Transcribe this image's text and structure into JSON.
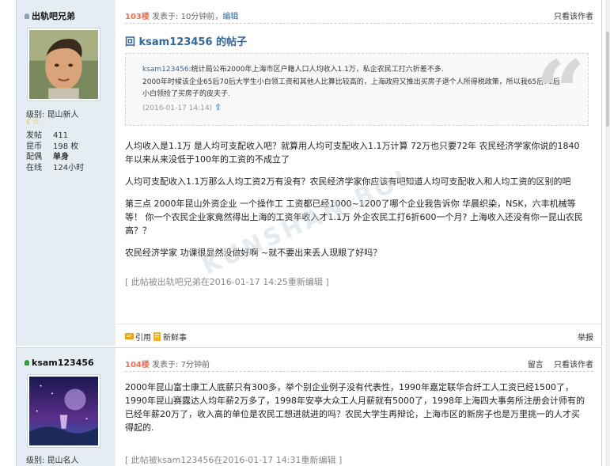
{
  "post1": {
    "author": "出轨吧兄弟",
    "level_label": "级别:",
    "level_value": "昆山新人",
    "stars": "☾☆",
    "stats": [
      {
        "label": "发帖",
        "value": "411"
      },
      {
        "label": "昆币",
        "value": "198 枚"
      },
      {
        "label": "配偶",
        "value": "单身"
      },
      {
        "label": "在线",
        "value": "124小时"
      }
    ],
    "floor": "103楼",
    "posted": "发表于: 10分钟前，",
    "edit": "编辑",
    "only_author": "只看该作者",
    "reply_title": "回 ksam123456 的帖子",
    "quote": {
      "author": "ksam123456",
      "line1": ":统计局公布2000年上海市区户籍人口人均收入1.1万，私企农民工打六折差不多.",
      "line2": "2000年时候该企业65后70后大学生小白领工资和其他人比算比较高的，上海政府又推出买房子退个人所得税政策，所以我65后70后小白领捡了买房子的皮夫子.",
      "meta": "(2016-01-17 14:14)",
      "arrow": "⇧"
    },
    "paragraphs": [
      "人均收入是1.1万 是人均可支配收入吧？就算用人均可支配收入1.1万计算  72万也只要72年 农民经济学家你说的1840年以来从来没低于100年的工资的不成立了",
      "人均可支配收入1.1万那么人均工资2万有没有？农民经济学家你应该有吧知道人均可支配收入和人均工资的区别的吧",
      "第三点  2000年昆山外资企业 一个操作工 工资都已经1000~1200了哪个企业我告诉你 华晨织染，NSK，六丰机械等等！  你一个农民企业家竟然得出上海的工资年收入才1.1万  外企农民工打6折600一个月? 上海收入还没有你一昆山农民高？？",
      "农民经济学家 功课很显然没做好啊 ~就不要出来丢人现眼了好吗？"
    ],
    "edit_note": "[ 此帖被出轨吧兄弟在2016-01-17 14:25重新编辑 ]",
    "watermark": "KUNSHAN.BOL",
    "action_quote": "引用",
    "action_gift": "新鲜事",
    "action_report": "举报"
  },
  "post2": {
    "author": "ksam123456",
    "level_label": "级别:",
    "level_value": "昆山名人",
    "floor": "104楼",
    "posted": "发表于: 7分钟前",
    "message": "留言",
    "only_author": "只看该作者",
    "paragraph": "2000年昆山富士康工人底薪只有300多，举个别企业例子没有代表性，1990年嘉定联华合纤工人工资已经1500了，1990年昆山赛露达人均年薪2万多了，1998年安亭大众工人月薪就有5000了，1998年上海四大事务所注册会计师有的已经年薪20万了，收入高的单位是农民工想进就进的吗？农民大学生再辩论，上海市区的新房子也是万里挑一的人才买得起的.",
    "edit_note": "[ 此帖被ksam123456在2016-01-17 14:31重新编辑 ]"
  },
  "colors": {
    "side_bg": "#e5edf2",
    "border": "#c2d5e3",
    "link": "#336699",
    "floor": "#f26c4f",
    "online": "#2e9e3e"
  }
}
